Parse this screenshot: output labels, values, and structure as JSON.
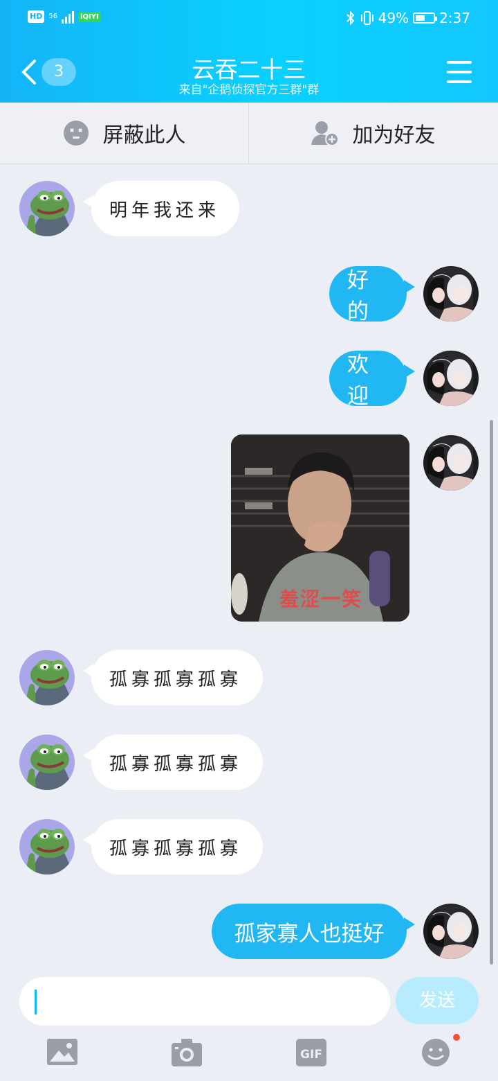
{
  "status_bar": {
    "hd": "HD",
    "network": "56",
    "battery_percent": "49%",
    "time": "2:37",
    "app_badge": "iQIYI"
  },
  "header": {
    "unread_count": "3",
    "title": "云吞二十三",
    "subtitle": "来自\"企鹅侦探官方三群\"群"
  },
  "actions": {
    "block_label": "屏蔽此人",
    "add_friend_label": "加为好友"
  },
  "messages": [
    {
      "side": "in",
      "text": "明年我还来"
    },
    {
      "side": "out",
      "text": "好的"
    },
    {
      "side": "out",
      "text": "欢迎"
    },
    {
      "side": "out",
      "type": "image",
      "caption": "羞涩一笑"
    },
    {
      "side": "in",
      "text": "孤寡孤寡孤寡"
    },
    {
      "side": "in",
      "text": "孤寡孤寡孤寡"
    },
    {
      "side": "in",
      "text": "孤寡孤寡孤寡"
    },
    {
      "side": "out",
      "text": "孤家寡人也挺好"
    }
  ],
  "composer": {
    "input_value": "",
    "send_label": "发送"
  },
  "toolbar": {
    "gif_label": "GIF",
    "items": [
      "image-icon",
      "camera-icon",
      "gif-icon",
      "emoji-icon"
    ]
  },
  "colors": {
    "accent": "#21b7f3",
    "header": "#14b4f7",
    "background": "#eceef5"
  }
}
